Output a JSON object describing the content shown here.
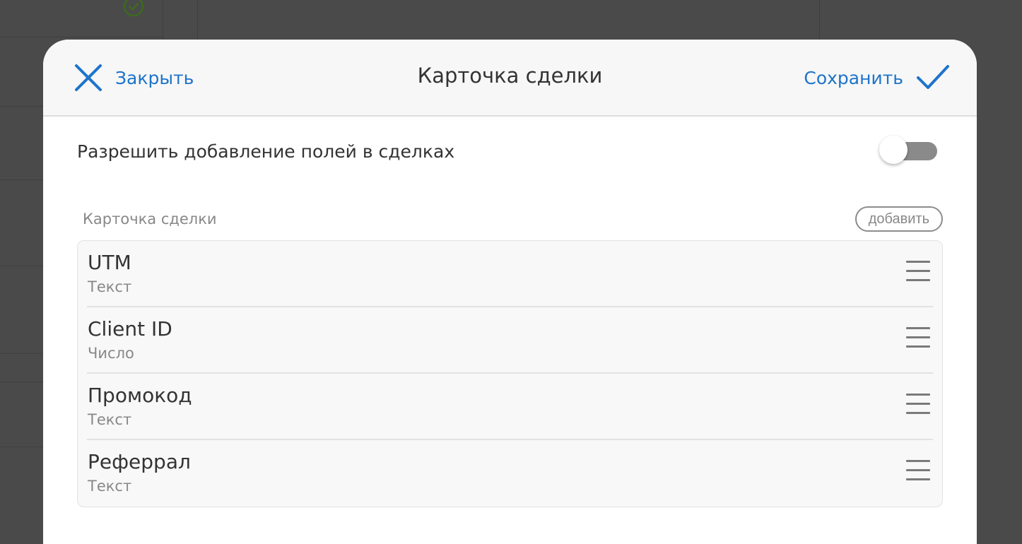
{
  "modal": {
    "title": "Карточка сделки",
    "close_label": "Закрыть",
    "save_label": "Сохранить"
  },
  "setting": {
    "label": "Разрешить добавление полей в сделках",
    "enabled": false
  },
  "section": {
    "title": "Карточка сделки",
    "add_label": "добавить"
  },
  "fields": [
    {
      "name": "UTM",
      "type": "Текст"
    },
    {
      "name": "Client ID",
      "type": "Число"
    },
    {
      "name": "Промокод",
      "type": "Текст"
    },
    {
      "name": "Реферрал",
      "type": "Текст"
    }
  ],
  "colors": {
    "accent": "#1d74cb",
    "overlay": "#4a4a4a",
    "check_background": "#3c7a1e"
  }
}
